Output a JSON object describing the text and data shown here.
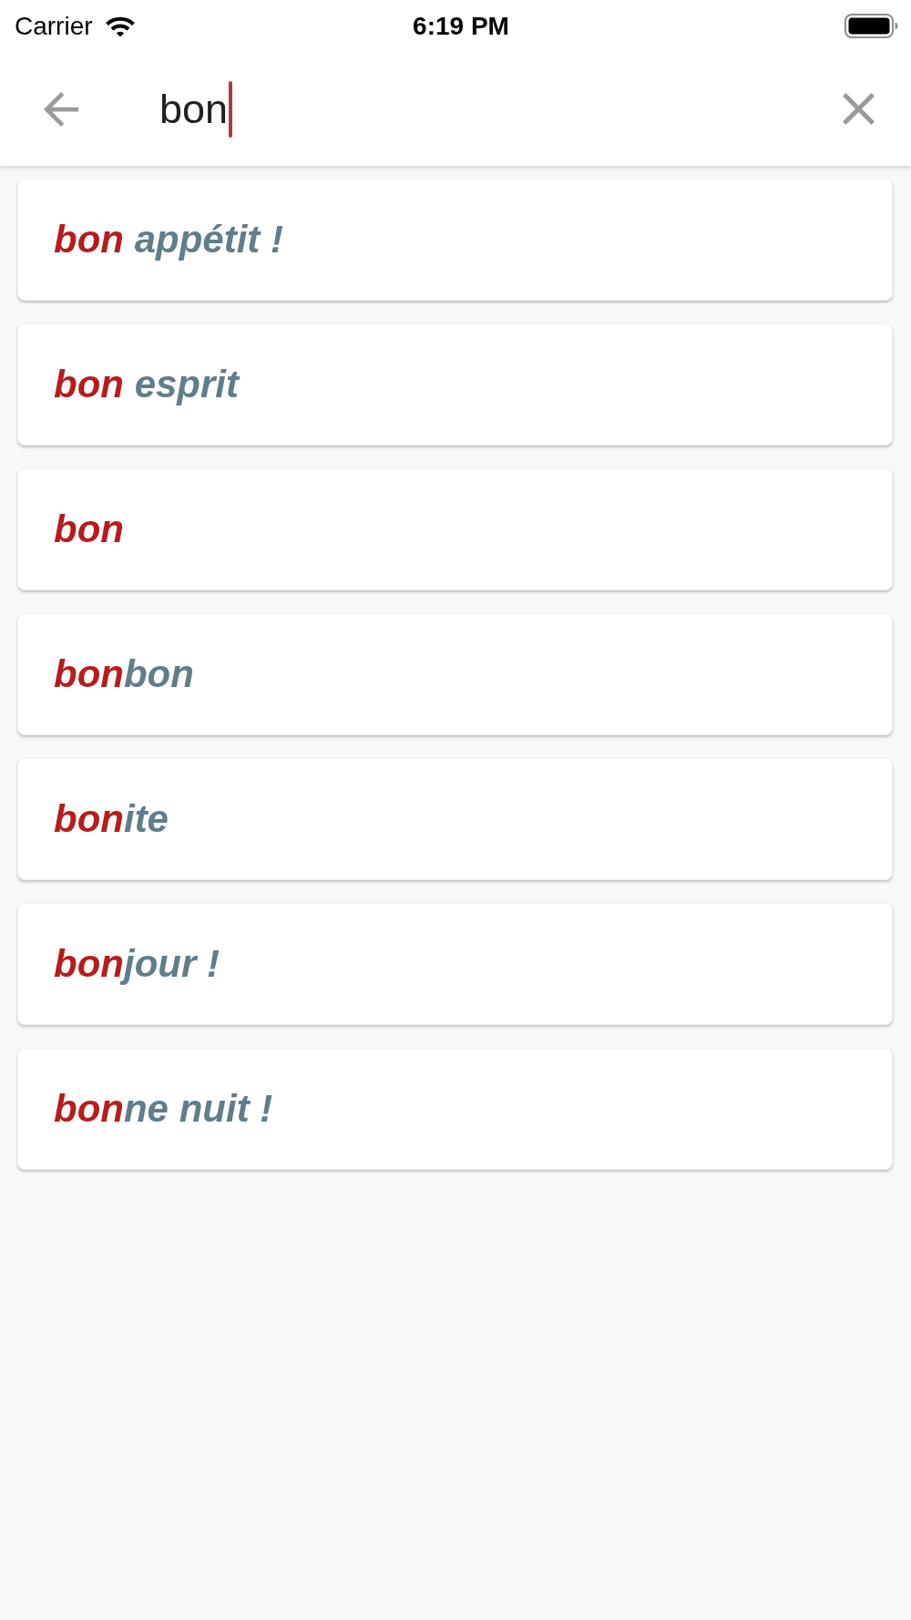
{
  "status_bar": {
    "carrier": "Carrier",
    "time": "6:19 PM"
  },
  "search": {
    "value": "bon"
  },
  "results": [
    {
      "match": "bon",
      "rest": " appétit !"
    },
    {
      "match": "bon",
      "rest": " esprit"
    },
    {
      "match": "bon"
    },
    {
      "match": "bon",
      "rest": "bon"
    },
    {
      "match": "bon",
      "rest": "ite"
    },
    {
      "match": "bon",
      "rest": "jour !"
    },
    {
      "match": "bon",
      "rest": "ne nuit !"
    }
  ]
}
